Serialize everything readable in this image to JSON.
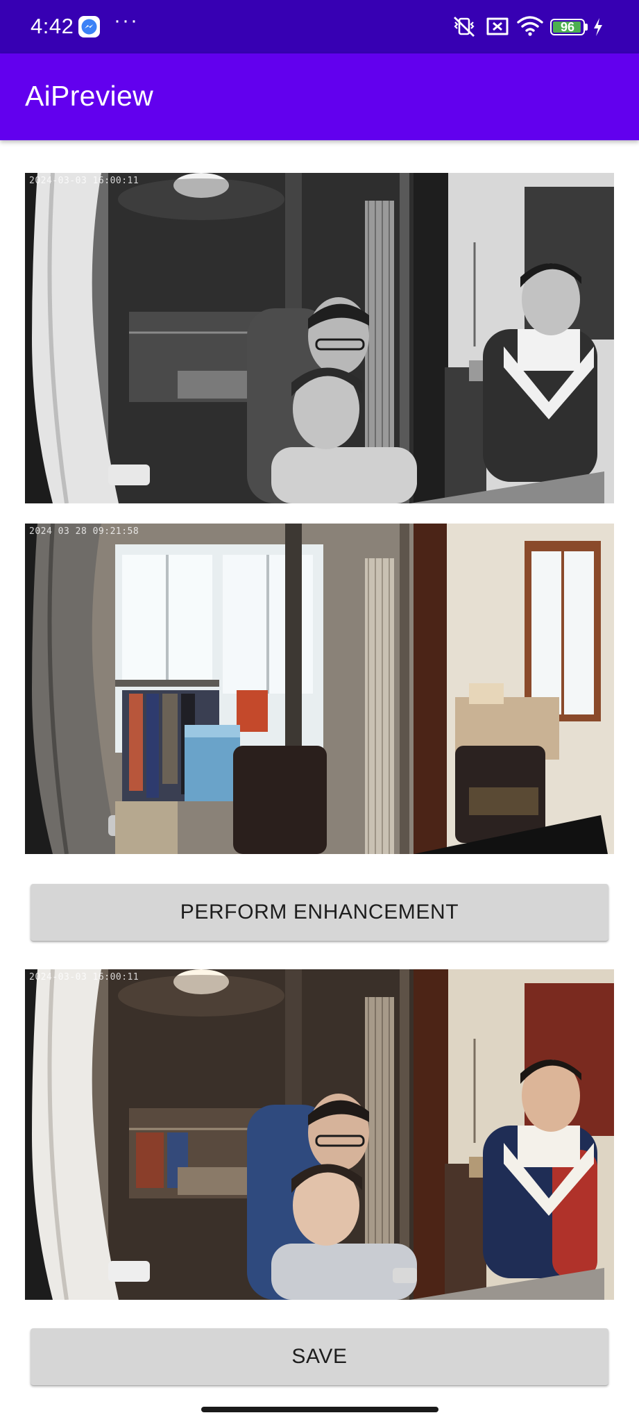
{
  "status_bar": {
    "time": "4:42",
    "more": "···",
    "battery_level": 96,
    "background": "#3700b3",
    "icons": [
      "messenger-icon",
      "vibrate-off-icon",
      "no-sim-icon",
      "wifi-icon",
      "battery-icon",
      "charging-bolt-icon"
    ]
  },
  "app_bar": {
    "title": "AiPreview",
    "background": "#6200ee"
  },
  "images": {
    "original": {
      "timestamp": "2024-03-03 16:00:11",
      "tone": "grayscale"
    },
    "reference": {
      "timestamp": "2024 03 28 09:21:58",
      "tone": "daylight-color"
    },
    "enhanced": {
      "timestamp": "2024-03-03 16:00:11",
      "tone": "colorized"
    }
  },
  "buttons": {
    "enhance_label": "PERFORM ENHANCEMENT",
    "save_label": "SAVE"
  }
}
